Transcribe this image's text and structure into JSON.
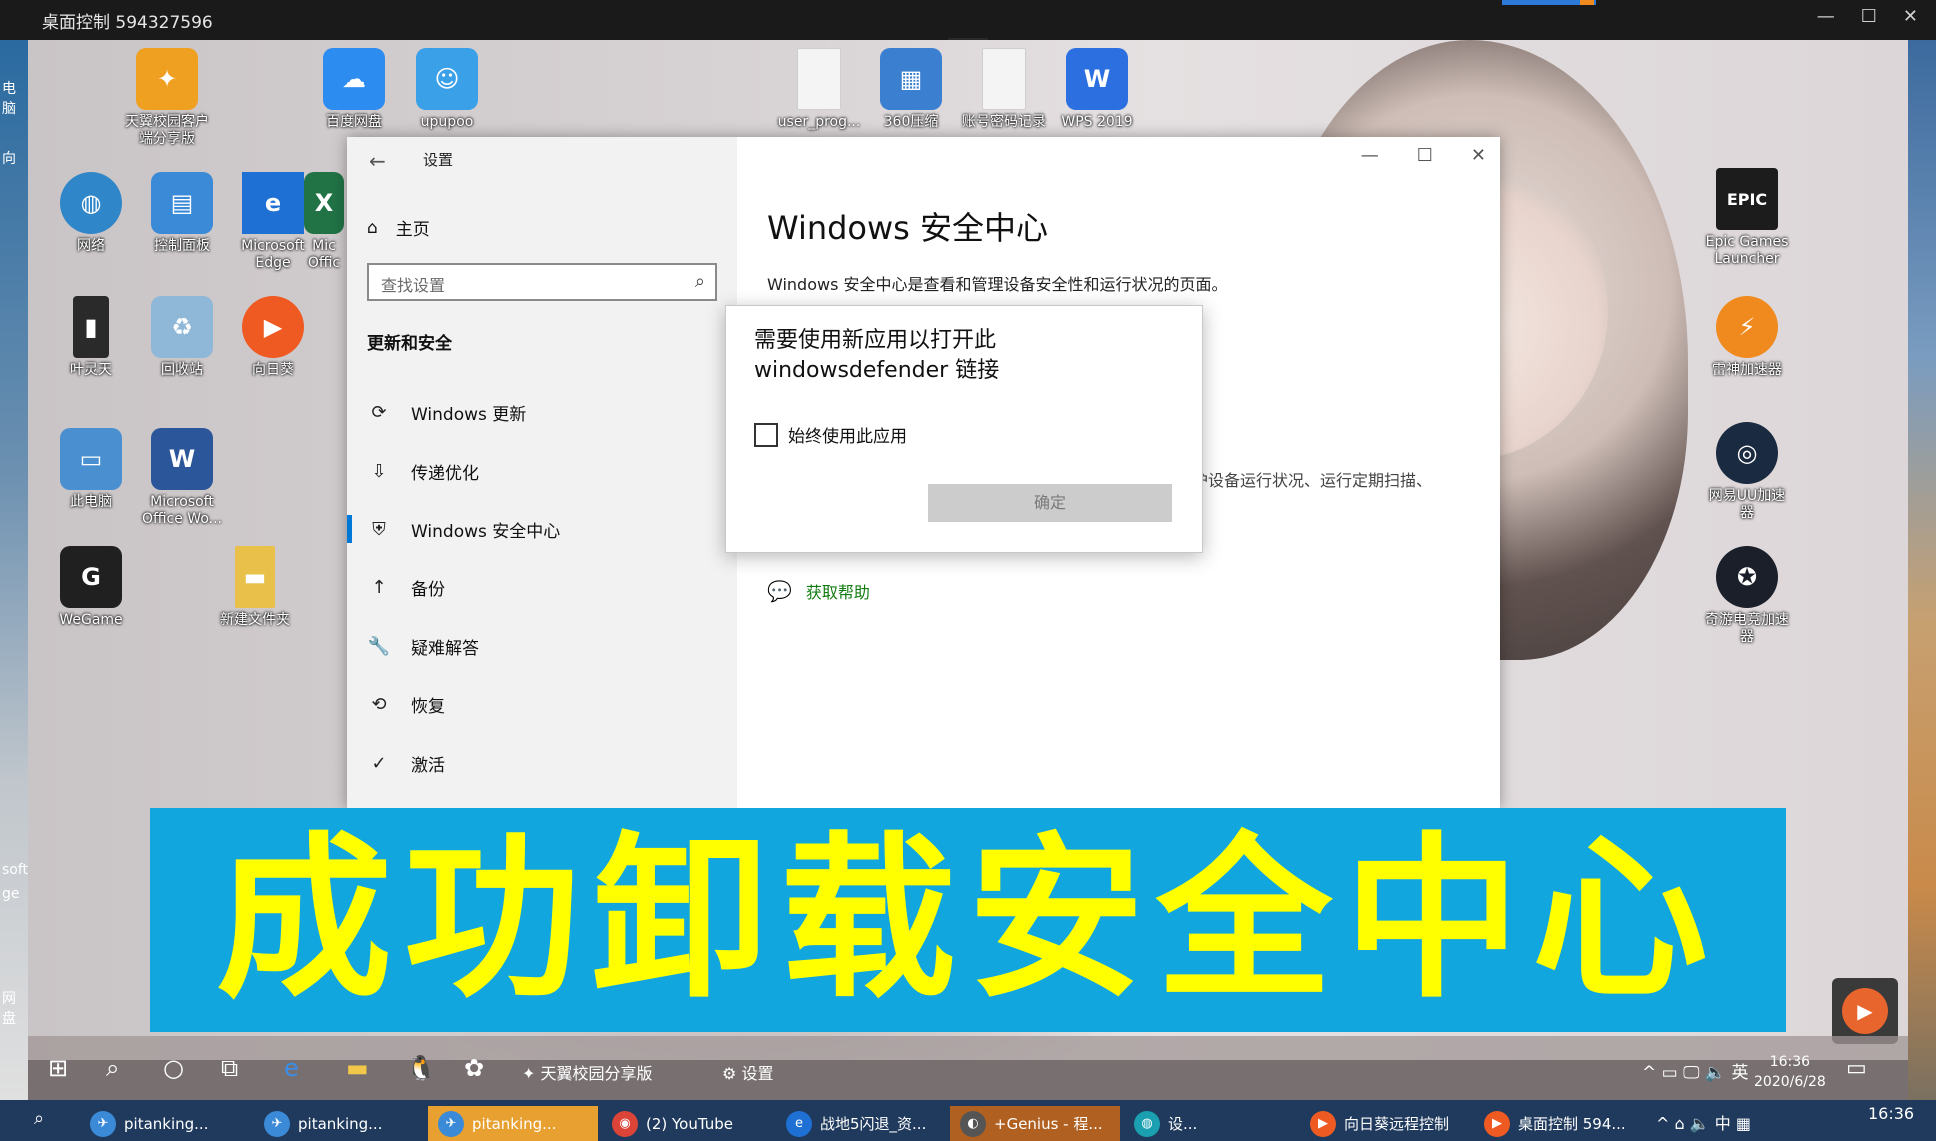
{
  "remote_window": {
    "title": "桌面控制 594327596",
    "minimize": "—",
    "maximize": "☐",
    "close": "✕",
    "dropdown": "⌄"
  },
  "local_left_labels": [
    "电脑",
    "向",
    "soft",
    "ge",
    "网盘"
  ],
  "desktop_icons": [
    {
      "label": "天翼校园客户端分享版",
      "glyph": "✦",
      "color": "#f0a020"
    },
    {
      "label": "百度网盘",
      "glyph": "☁",
      "color": "#2c8cf0"
    },
    {
      "label": "upupoo",
      "glyph": "☺",
      "color": "#3aa0e8"
    },
    {
      "label": "user_prog...",
      "glyph": "",
      "color": "#f4f4f4"
    },
    {
      "label": "360压缩",
      "glyph": "▦",
      "color": "#3a7fd0"
    },
    {
      "label": "账号密码记录",
      "glyph": "",
      "color": "#f4f4f4"
    },
    {
      "label": "WPS 2019",
      "glyph": "W",
      "color": "#2b6fe0"
    },
    {
      "label": "网络",
      "glyph": "◍",
      "color": "#2f86c8"
    },
    {
      "label": "控制面板",
      "glyph": "▤",
      "color": "#3a8ad8"
    },
    {
      "label": "Microsoft Edge",
      "glyph": "e",
      "color": "#1e70d4"
    },
    {
      "label": "Mic Offic",
      "glyph": "X",
      "color": "#217346"
    },
    {
      "label": "叶灵天",
      "glyph": "▮",
      "color": "#2a2a2a"
    },
    {
      "label": "回收站",
      "glyph": "♻",
      "color": "#8fb8d8"
    },
    {
      "label": "向日葵",
      "glyph": "▶",
      "color": "#ef5a22"
    },
    {
      "label": "此电脑",
      "glyph": "▭",
      "color": "#4a90d0"
    },
    {
      "label": "Microsoft Office Wo...",
      "glyph": "W",
      "color": "#2b579a"
    },
    {
      "label": "WeGame",
      "glyph": "G",
      "color": "#202020"
    },
    {
      "label": "新建文件夹",
      "glyph": "▬",
      "color": "#e8c04a"
    },
    {
      "label": "Epic Games Launcher",
      "glyph": "EPIC",
      "color": "#1c1c1c"
    },
    {
      "label": "雷神加速器",
      "glyph": "⚡",
      "color": "#f08a1f"
    },
    {
      "label": "网易UU加速器",
      "glyph": "◎",
      "color": "#1a2a40"
    },
    {
      "label": "奇游电竞加速器",
      "glyph": "✪",
      "color": "#1a1f2a"
    }
  ],
  "settings": {
    "back": "←",
    "app_title": "设置",
    "home_label": "主页",
    "search_placeholder": "查找设置",
    "section": "更新和安全",
    "nav_items": [
      {
        "label": "Windows 更新",
        "icon": "⟳"
      },
      {
        "label": "传递优化",
        "icon": "⇩"
      },
      {
        "label": "Windows 安全中心",
        "icon": "⛨"
      },
      {
        "label": "备份",
        "icon": "↑"
      },
      {
        "label": "疑难解答",
        "icon": "🔧"
      },
      {
        "label": "恢复",
        "icon": "⟲"
      },
      {
        "label": "激活",
        "icon": "✓"
      }
    ],
    "page_title": "Windows 安全中心",
    "page_desc": "Windows 安全中心是查看和管理设备安全性和运行状况的页面。",
    "partial_text": "护设备运行状况、运行定期扫描、",
    "help_link": "获取帮助",
    "minimize": "—",
    "maximize": "☐",
    "close": "✕"
  },
  "dialog": {
    "title": "需要使用新应用以打开此 windowsdefender 链接",
    "checkbox_label": "始终使用此应用",
    "ok_label": "确定"
  },
  "banner": {
    "text": "成功卸载安全中心"
  },
  "remote_taskbar": {
    "items": [
      {
        "label": "天翼校园分享版"
      },
      {
        "label": "设置"
      }
    ],
    "tray": "^ ▭ 🖵 🔈 英",
    "time": "16:36",
    "date": "2020/6/28",
    "notif": "▭"
  },
  "local_taskbar": {
    "tasks": [
      {
        "label": "pitanking...",
        "color": "#3a8ad8"
      },
      {
        "label": "pitanking...",
        "color": "#3a8ad8"
      },
      {
        "label": "pitanking...",
        "color": "#3a8ad8"
      },
      {
        "label": "(2) YouTube",
        "color": "#db4437"
      },
      {
        "label": "战地5闪退_资...",
        "color": "#1e70d4"
      },
      {
        "label": "+Genius - 程...",
        "color": "#555555"
      },
      {
        "label": "设...",
        "color": "#1aa0b0"
      },
      {
        "label": "向日葵远程控制",
        "color": "#ef5a22"
      },
      {
        "label": "桌面控制 594...",
        "color": "#ef5a22"
      }
    ],
    "tray": "^ ⌂ 🔈 中 ▦",
    "time": "16:36"
  }
}
